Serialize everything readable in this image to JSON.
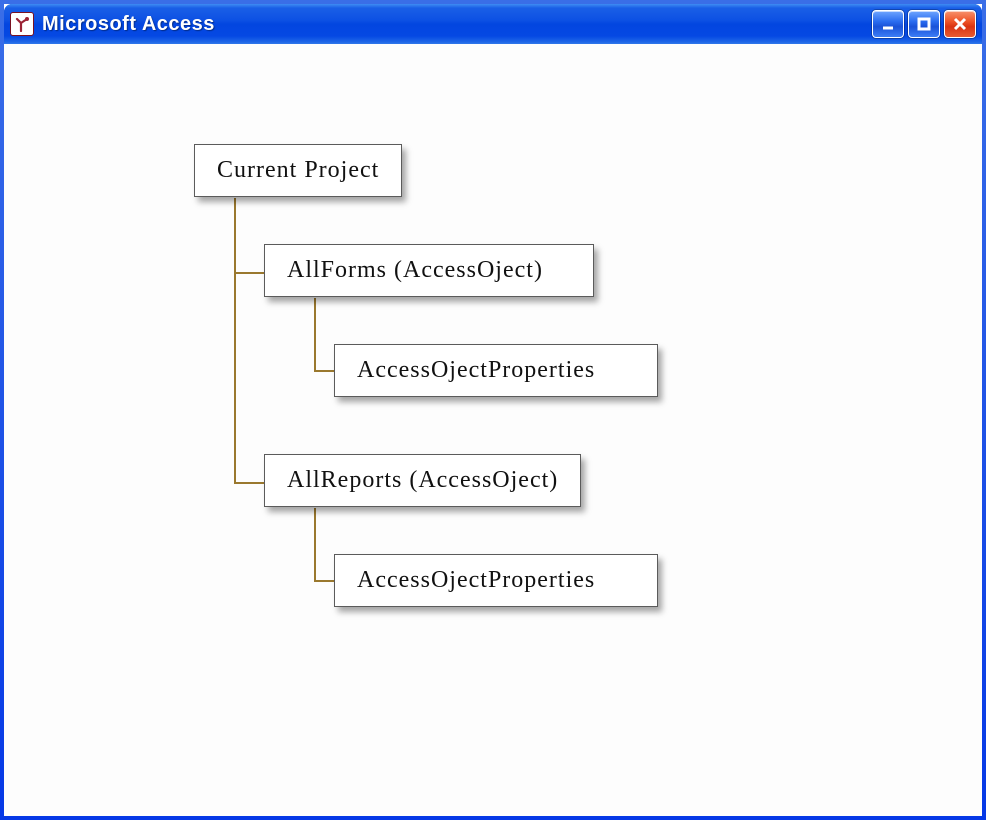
{
  "window": {
    "title": "Microsoft Access"
  },
  "tree": {
    "root": "Current Project",
    "forms": "AllForms (AccessOject)",
    "forms_prop": "AccessOjectProperties",
    "reports": "AllReports (AccessOject)",
    "reports_prop": "AccessOjectProperties"
  }
}
